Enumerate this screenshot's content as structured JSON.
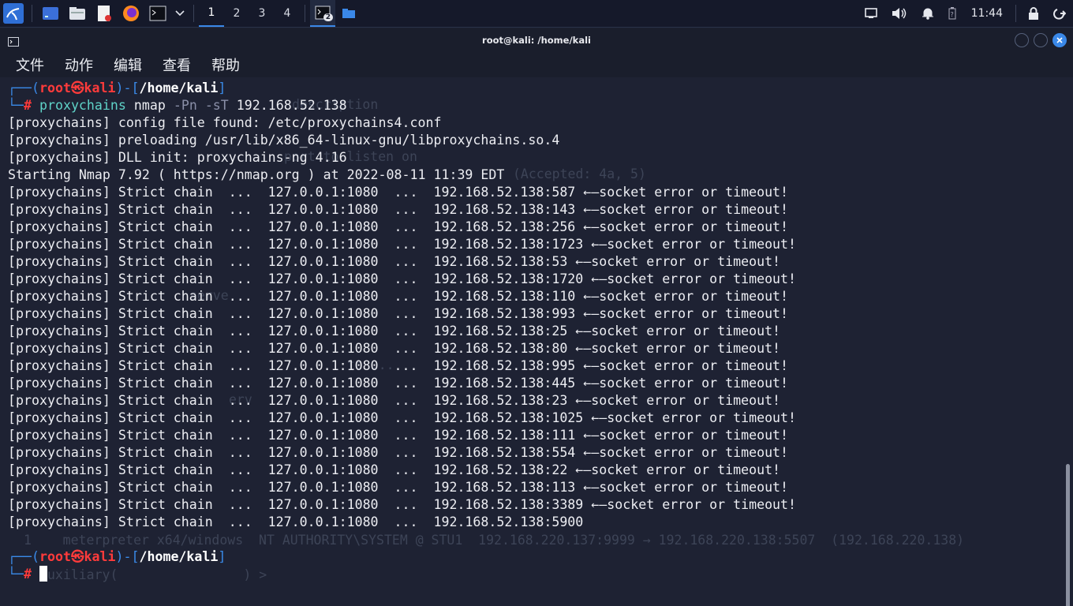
{
  "taskbar": {
    "workspaces": [
      "1",
      "2",
      "3",
      "4"
    ],
    "active_workspace": "1",
    "task_badge": "2",
    "clock": "11:44",
    "icons": [
      "kali-menu-icon",
      "desktop-icon",
      "file-manager-icon",
      "text-editor-icon",
      "firefox-icon",
      "terminal-icon",
      "dropdown-chevron-icon",
      "terminal-task-icon",
      "folder-task-icon",
      "display-icon",
      "volume-icon",
      "notification-bell-icon",
      "battery-icon",
      "lock-icon",
      "power-icon"
    ]
  },
  "window": {
    "title": "root@kali: /home/kali",
    "menu": [
      "文件",
      "动作",
      "编辑",
      "查看",
      "帮助"
    ]
  },
  "prompt": {
    "user": "root",
    "host": "kali",
    "skull": "㉿",
    "path": "/home/kali"
  },
  "terminal": {
    "command": {
      "name": "proxychains",
      "prog": "nmap",
      "flags": "-Pn -sT",
      "target": "192.168.52.138"
    },
    "info_lines": [
      "[proxychains] config file found: /etc/proxychains4.conf",
      "[proxychains] preloading /usr/lib/x86_64-linux-gnu/libproxychains.so.4",
      "[proxychains] DLL init: proxychains-ng 4.16",
      "Starting Nmap 7.92 ( https://nmap.org ) at 2022-08-11 11:39 EDT"
    ],
    "chain_lines": [
      "[proxychains] Strict chain  ...  127.0.0.1:1080  ...  192.168.52.138:587 ←—socket error or timeout!",
      "[proxychains] Strict chain  ...  127.0.0.1:1080  ...  192.168.52.138:143 ←—socket error or timeout!",
      "[proxychains] Strict chain  ...  127.0.0.1:1080  ...  192.168.52.138:256 ←—socket error or timeout!",
      "[proxychains] Strict chain  ...  127.0.0.1:1080  ...  192.168.52.138:1723 ←—socket error or timeout!",
      "[proxychains] Strict chain  ...  127.0.0.1:1080  ...  192.168.52.138:53 ←—socket error or timeout!",
      "[proxychains] Strict chain  ...  127.0.0.1:1080  ...  192.168.52.138:1720 ←—socket error or timeout!",
      "[proxychains] Strict chain  ...  127.0.0.1:1080  ...  192.168.52.138:110 ←—socket error or timeout!",
      "[proxychains] Strict chain  ...  127.0.0.1:1080  ...  192.168.52.138:993 ←—socket error or timeout!",
      "[proxychains] Strict chain  ...  127.0.0.1:1080  ...  192.168.52.138:25 ←—socket error or timeout!",
      "[proxychains] Strict chain  ...  127.0.0.1:1080  ...  192.168.52.138:80 ←—socket error or timeout!",
      "[proxychains] Strict chain  ...  127.0.0.1:1080  ...  192.168.52.138:995 ←—socket error or timeout!",
      "[proxychains] Strict chain  ...  127.0.0.1:1080  ...  192.168.52.138:445 ←—socket error or timeout!",
      "[proxychains] Strict chain  ...  127.0.0.1:1080  ...  192.168.52.138:23 ←—socket error or timeout!",
      "[proxychains] Strict chain  ...  127.0.0.1:1080  ...  192.168.52.138:1025 ←—socket error or timeout!",
      "[proxychains] Strict chain  ...  127.0.0.1:1080  ...  192.168.52.138:111 ←—socket error or timeout!",
      "[proxychains] Strict chain  ...  127.0.0.1:1080  ...  192.168.52.138:554 ←—socket error or timeout!",
      "[proxychains] Strict chain  ...  127.0.0.1:1080  ...  192.168.52.138:22 ←—socket error or timeout!",
      "[proxychains] Strict chain  ...  127.0.0.1:1080  ...  192.168.52.138:113 ←—socket error or timeout!",
      "[proxychains] Strict chain  ...  127.0.0.1:1080  ...  192.168.52.138:3389 ←—socket error or timeout!",
      "[proxychains] Strict chain  ...  127.0.0.1:1080  ...  192.168.52.138:5900"
    ]
  },
  "background_ghost": [
    "description",
    "port to listen on",
    "(Accepted: 4a, 5)",
    "serve",
    "to ...",
    "erv",
    "1    meterpreter x64/windows  NT AUTHORITY\\SYSTEM @ STU1  192.168.220.137:9999 → 192.168.220.138:5507  (192.168.220.138)",
    "uxiliary(                ) > "
  ],
  "colors": {
    "prompt_frame": "#3a8ae8",
    "prompt_user": "#ff3b3b",
    "command_name": "#5fd3c8",
    "terminal_bg": "#1e2233",
    "text": "#ecedf2"
  }
}
